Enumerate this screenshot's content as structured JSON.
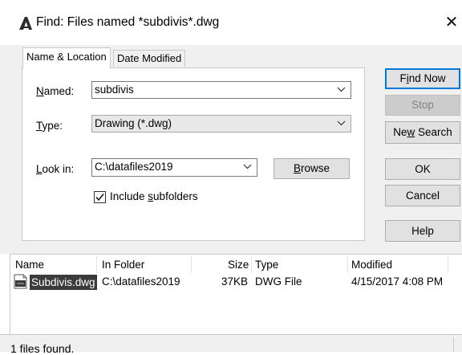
{
  "window": {
    "title": "Find: Files named *subdivis*.dwg",
    "close_glyph": "✕",
    "app_icon": "autocad-logo-icon"
  },
  "tabs": [
    {
      "label": "Name & Location",
      "active": true
    },
    {
      "label": "Date Modified",
      "active": false
    }
  ],
  "form": {
    "named_label_pre": "",
    "named_label_key": "N",
    "named_label_post": "amed:",
    "named_value": "subdivis",
    "type_label_key": "T",
    "type_label_post": "ype:",
    "type_value": "Drawing (*.dwg)",
    "lookin_label_key": "L",
    "lookin_label_post": "ook in:",
    "lookin_value": "C:\\datafiles2019",
    "browse_key": "B",
    "browse_post": "rowse",
    "include_pre": "Include ",
    "include_key": "s",
    "include_post": "ubfolders",
    "include_checked": true
  },
  "buttons": {
    "find_pre": "F",
    "find_key": "i",
    "find_post": "nd Now",
    "stop": "Stop",
    "new_pre": "Ne",
    "new_key": "w",
    "new_post": " Search",
    "ok": "OK",
    "cancel": "Cancel",
    "help": "Help"
  },
  "results": {
    "columns": [
      "Name",
      "In Folder",
      "Size",
      "Type",
      "Modified"
    ],
    "rows": [
      {
        "name": "Subdivis.dwg",
        "folder": "C:\\datafiles2019",
        "size": "37KB",
        "type": "DWG File",
        "modified": "4/15/2017 4:08 PM"
      }
    ]
  },
  "status": {
    "text": "1 files found."
  },
  "colors": {
    "accent": "#0078d7",
    "selection": "#3b3b3b",
    "dialog_bg": "#f0f0f0"
  }
}
